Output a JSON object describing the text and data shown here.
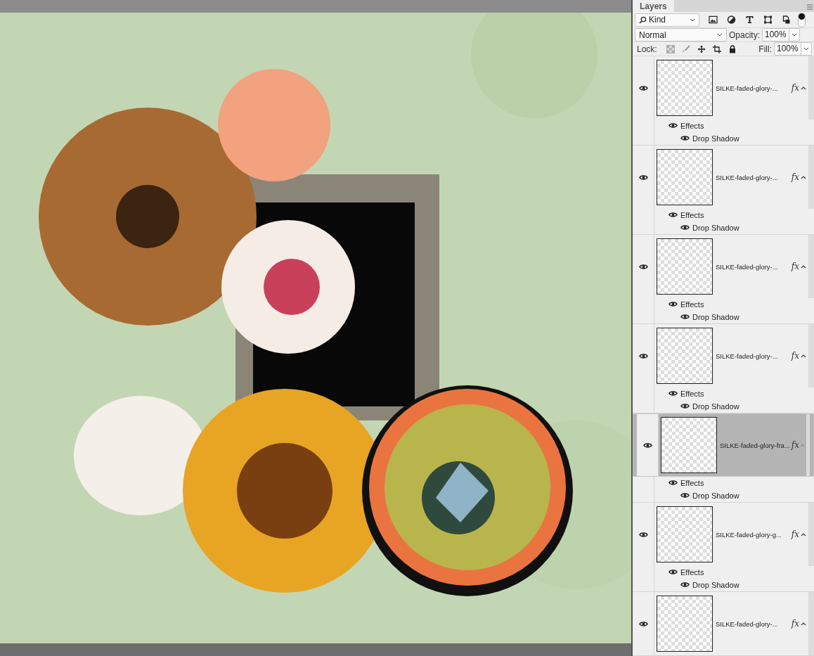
{
  "panel": {
    "tab": {
      "label": "Layers",
      "selected": true
    },
    "filter": {
      "value": "Kind"
    },
    "blend_mode": {
      "value": "Normal"
    },
    "opacity": {
      "label": "Opacity:",
      "value": "100%"
    },
    "lock": {
      "label": "Lock:"
    },
    "fill": {
      "label": "Fill:",
      "value": "100%"
    }
  },
  "layers": [
    {
      "name": "SILKE-faded-glory-...",
      "visible": true,
      "selected": false,
      "fx": "fx",
      "effects": {
        "label": "Effects",
        "visible": true,
        "items": [
          {
            "name": "Drop Shadow",
            "visible": true
          }
        ]
      }
    },
    {
      "name": "SILKE-faded-glory-...",
      "visible": true,
      "selected": false,
      "fx": "fx",
      "effects": {
        "label": "Effects",
        "visible": true,
        "items": [
          {
            "name": "Drop Shadow",
            "visible": true
          }
        ]
      }
    },
    {
      "name": "SILKE-faded-glory-...",
      "visible": true,
      "selected": false,
      "fx": "fx",
      "effects": {
        "label": "Effects",
        "visible": true,
        "items": [
          {
            "name": "Drop Shadow",
            "visible": true
          }
        ]
      }
    },
    {
      "name": "SILKE-faded-glory-...",
      "visible": true,
      "selected": false,
      "fx": "fx",
      "effects": {
        "label": "Effects",
        "visible": true,
        "items": [
          {
            "name": "Drop Shadow",
            "visible": true
          }
        ]
      }
    },
    {
      "name": "SILKE-faded-glory-fra...",
      "visible": true,
      "selected": true,
      "fx": "fx",
      "effects": {
        "label": "Effects",
        "visible": true,
        "items": [
          {
            "name": "Drop Shadow",
            "visible": true
          }
        ]
      }
    },
    {
      "name": "SILKE-faded-glory-g...",
      "visible": true,
      "selected": false,
      "fx": "fx",
      "effects": {
        "label": "Effects",
        "visible": true,
        "items": [
          {
            "name": "Drop Shadow",
            "visible": true
          }
        ]
      }
    },
    {
      "name": "SILKE-faded-glory-...",
      "visible": true,
      "selected": false,
      "fx": "fx"
    }
  ]
}
